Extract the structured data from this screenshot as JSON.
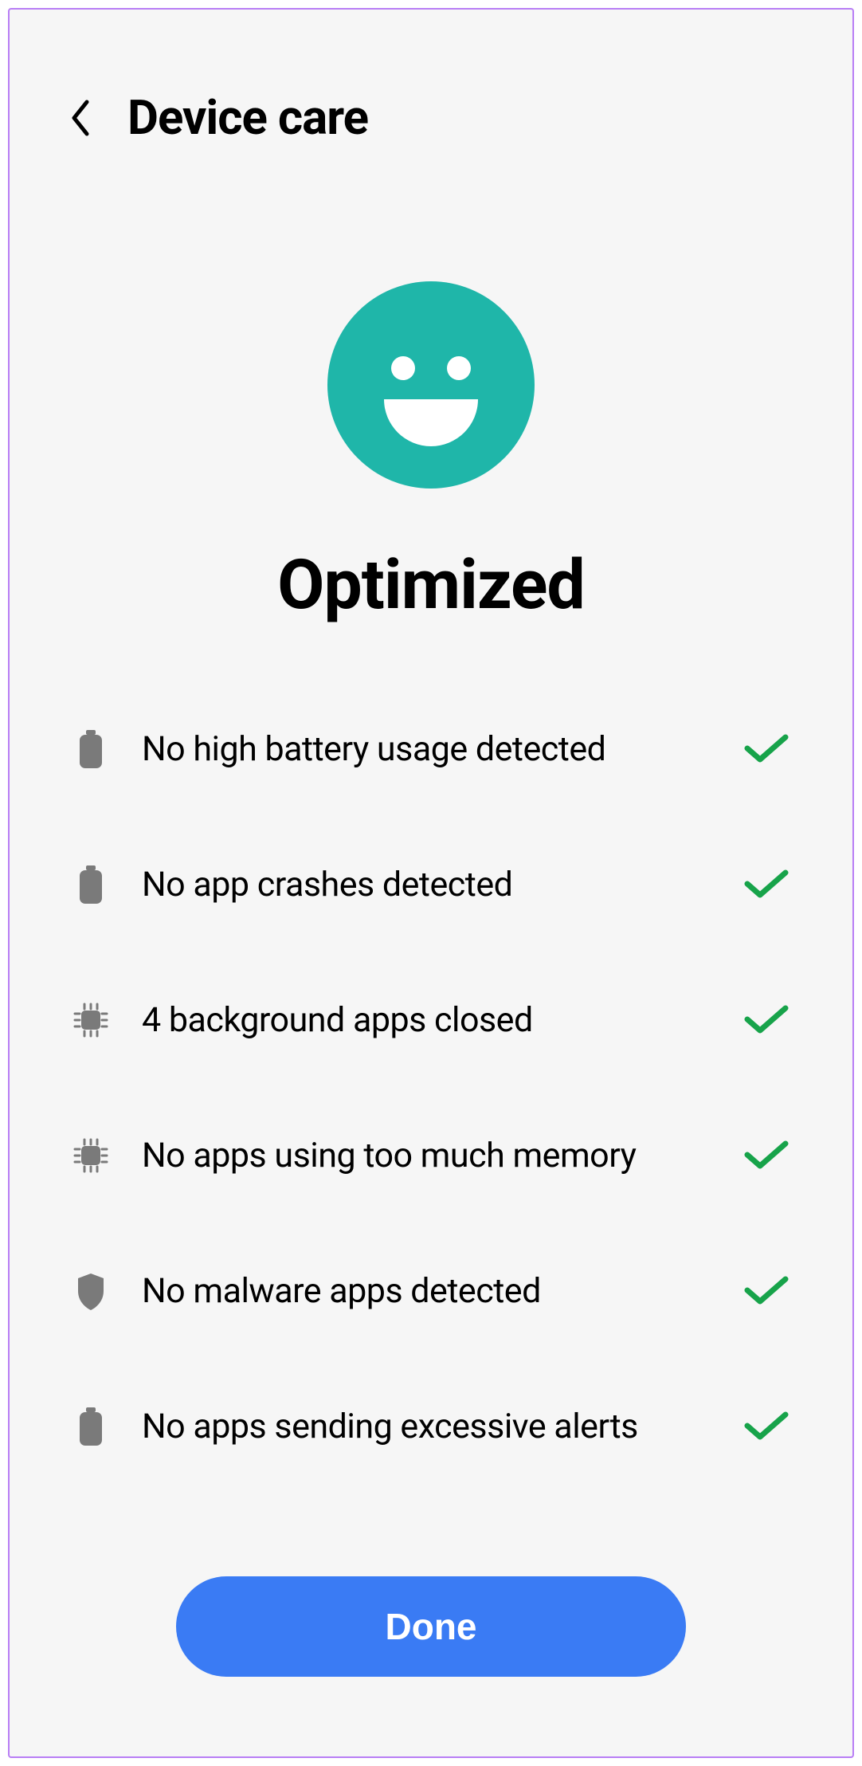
{
  "header": {
    "title": "Device care"
  },
  "hero": {
    "status": "Optimized"
  },
  "items": [
    {
      "icon": "battery",
      "label": "No high battery usage detected"
    },
    {
      "icon": "battery",
      "label": "No app crashes detected"
    },
    {
      "icon": "chip",
      "label": "4 background apps closed"
    },
    {
      "icon": "chip",
      "label": "No apps using too much memory"
    },
    {
      "icon": "shield",
      "label": "No malware apps detected"
    },
    {
      "icon": "battery",
      "label": "No apps sending excessive alerts"
    }
  ],
  "actions": {
    "done": "Done"
  },
  "colors": {
    "accent": "#3a7bf4",
    "face": "#1fb6a9",
    "check": "#17a34a",
    "iconGrey": "#7a7a7a"
  }
}
